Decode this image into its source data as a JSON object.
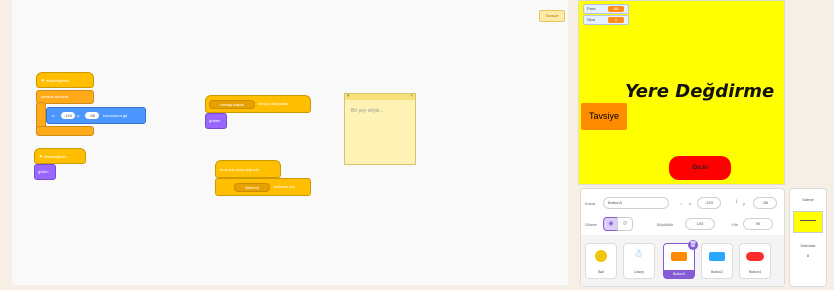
{
  "code": {
    "top_right_chip": "Tavsiye",
    "stack1": {
      "hat": "⚑ tıklandığında",
      "line1": "sonsuz tekrarla",
      "goto_label": "konumuna git",
      "x_val": "-193",
      "y_val": "-58"
    },
    "stack2": {
      "hat": "⚑ tıklandığında",
      "cmd": "gizlen"
    },
    "stack3": {
      "hat_a": "mesajı aldığında",
      "hat_dropdown": "mesajı başlat",
      "cmd": "göster"
    },
    "stack4": {
      "hat": "bu kukla tıklandığında",
      "dropdown": "dökümü",
      "tail": "haberini sal"
    },
    "note": {
      "text": "Bir şey söyle..."
    }
  },
  "stage": {
    "monitors": [
      {
        "label": "Para",
        "value": "85"
      },
      {
        "label": "Skor",
        "value": "0"
      }
    ],
    "title": "Yere Değdirme",
    "tavsiye": "Tavsiye",
    "go": "Go.lo"
  },
  "sprite_info": {
    "kukla_label": "Kukla",
    "kukla_value": "Button3",
    "x_label": "x",
    "x_value": "-193",
    "y_label": "y",
    "y_value": "-58",
    "show_label": "Göster",
    "size_label": "Büyüklük",
    "size_value": "100",
    "dir_label": "Yön",
    "dir_value": "90"
  },
  "sprites": [
    {
      "name": "Ball",
      "color": "#f2c30f"
    },
    {
      "name": "Casey",
      "color": "#4aa8ff"
    },
    {
      "name": "Button3",
      "color": "#ff8c00"
    },
    {
      "name": "Button2",
      "color": "#2aa8ff"
    },
    {
      "name": "Button4",
      "color": "#ff2a2a"
    }
  ],
  "backdrop": {
    "title": "Sahne",
    "label": "Dekorlar",
    "count": "8"
  },
  "colors": {
    "stage_bg": "#ffff00",
    "accent": "#855cd6"
  }
}
